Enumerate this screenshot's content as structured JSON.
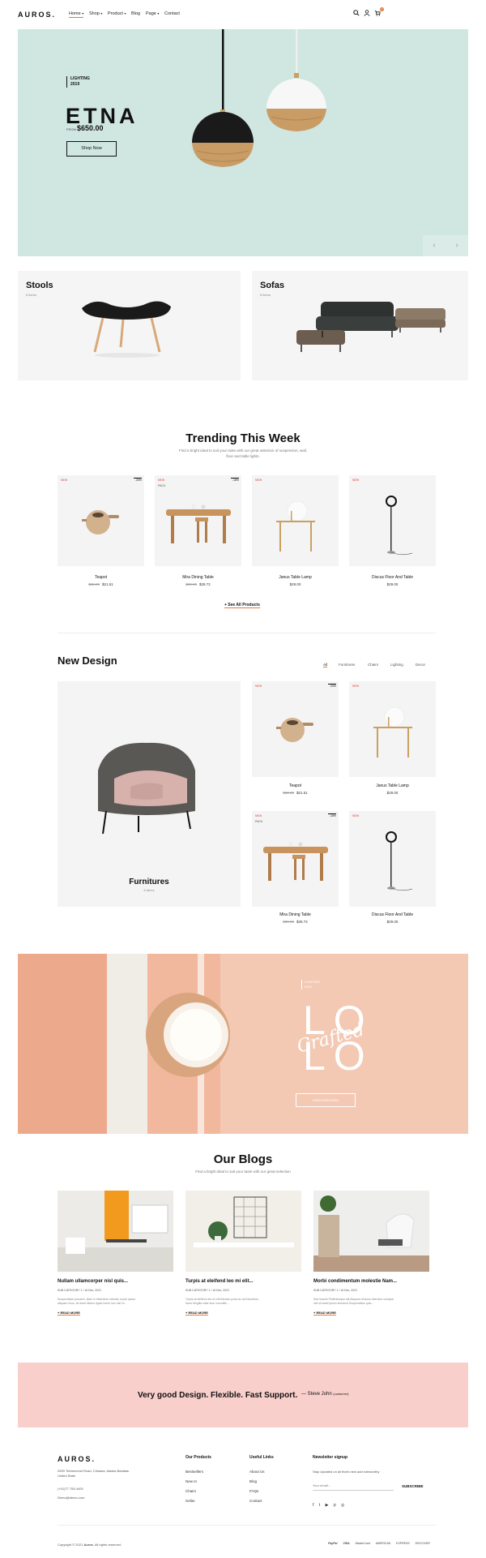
{
  "header": {
    "logo": "AUROS.",
    "nav": [
      {
        "label": "Home",
        "caret": "▾"
      },
      {
        "label": "Shop",
        "caret": "▾"
      },
      {
        "label": "Product",
        "caret": "▾"
      },
      {
        "label": "Blog",
        "caret": ""
      },
      {
        "label": "Page",
        "caret": "▾"
      },
      {
        "label": "Contact",
        "caret": ""
      }
    ],
    "cart_count": "0",
    "accent": "#e07a3f"
  },
  "hero": {
    "tag_line1": "LIGHTING",
    "tag_line2": "2019",
    "title": "ETNA",
    "price_label": "FROM",
    "price": "$650.00",
    "button": "Shop Now",
    "prev_icon": "‹",
    "next_icon": "›",
    "bg_color": "#cfe6e1"
  },
  "categories": [
    {
      "title": "Stools",
      "count": "6 items"
    },
    {
      "title": "Sofas",
      "count": "6 items"
    }
  ],
  "trending": {
    "title": "Trending This Week",
    "subtitle1": "Find a bright ideal to suit your taste with our great selection of suspension, wall,",
    "subtitle2": "floor and table lights.",
    "products": [
      {
        "name": "Teapot",
        "old_price": "$32.00",
        "price": "$21.51",
        "badge": "NEW",
        "badge2": "-33%",
        "badge3": ""
      },
      {
        "name": "Mira Dining Table",
        "old_price": "$30.00",
        "price": "$28.72",
        "badge": "NEW",
        "badge2": "-18%",
        "badge3": "PACK"
      },
      {
        "name": "Janus Table Lamp",
        "old_price": "",
        "price": "$29.00",
        "badge": "NEW",
        "badge2": "",
        "badge3": ""
      },
      {
        "name": "Discus Floor And Table",
        "old_price": "",
        "price": "$29.00",
        "badge": "NEW",
        "badge2": "",
        "badge3": ""
      }
    ],
    "see_all": "+ See All Products"
  },
  "new_design": {
    "title": "New Design",
    "tabs": [
      "All",
      "Furnitures",
      "Chairs",
      "Lighting",
      "Decor"
    ],
    "feature_title": "Furnitures",
    "feature_count": "6 items",
    "products": [
      {
        "name": "Teapot",
        "old_price": "$32.00",
        "price": "$21.51",
        "badge": "NEW",
        "badge2": "-33%",
        "badge3": ""
      },
      {
        "name": "Janus Table Lamp",
        "old_price": "",
        "price": "$29.00",
        "badge": "NEW",
        "badge2": "",
        "badge3": ""
      },
      {
        "name": "Mira Dining Table",
        "old_price": "$30.00",
        "price": "$28.72",
        "badge": "NEW",
        "badge2": "-18%",
        "badge3": "PACK"
      },
      {
        "name": "Discus Floor And Table",
        "old_price": "",
        "price": "$29.00",
        "badge": "NEW",
        "badge2": "",
        "badge3": ""
      }
    ]
  },
  "banner": {
    "tag_line1": "LIGHTING",
    "tag_line2": "2019",
    "big_top": "LO",
    "big_bottom": "LO",
    "script": "Crafted",
    "button": "DISCOVER NOW"
  },
  "blogs": {
    "title": "Our Blogs",
    "subtitle": "Find a bright ideal to suit your taste with our great selection",
    "posts": [
      {
        "title": "Nullam ullamcorper nisl quis...",
        "category": "SUB CATEGORY 1",
        "date": "16 Dec, 2021",
        "excerpt1": "Suspendisse posuere, diam in bibendum lobortis, turpis ipsum",
        "excerpt2": "aliquam risus, sit amet dictum ligula lorem non nisl Ur...",
        "more": "+ READ MORE"
      },
      {
        "title": "Turpis at eleifend leo mi elit...",
        "category": "SUB CATEGORY 1",
        "date": "16 Dec, 2021",
        "excerpt1": "Turpis at eleifend leo mi elit Aenean porta ac sed faucibus.",
        "excerpt2": "Nunc fringilla vitae arcu convallis...",
        "more": "+ READ MORE"
      },
      {
        "title": "Morbi condimentum molestie Nam...",
        "category": "SUB CATEGORY 1",
        "date": "16 Dec, 2021",
        "excerpt1": "Sed mauris Pellentesque elit Aliquam at lacus interdum volutpat",
        "excerpt2": "nisl sit amet ipsum tincidunt Suspendisse quis...",
        "more": "+ READ MORE"
      }
    ]
  },
  "tagline": {
    "text": "Very good Design. Flexible. Fast Support.",
    "dash": "—",
    "author": "Steve John",
    "author_role": "(customer)"
  },
  "footer": {
    "logo": "AUROS.",
    "address1": "2593 Timbercrest Road, Chisana, Alaska Badalas",
    "address2": "United State",
    "phone": "(+01)77 755 4400",
    "email": "Demo@demo.com",
    "products_head": "Our Products",
    "products": [
      "Bestsellers",
      "New In",
      "Chairs",
      "Sofas"
    ],
    "links_head": "Useful Links",
    "links": [
      "About Us",
      "Blog",
      "FAQs",
      "Contact"
    ],
    "newsletter_head": "Newsletter signup",
    "newsletter_text": "Stay Updated on all that's new add noteworthy",
    "email_placeholder": "Your email...",
    "subscribe": "SUBSCRIBE",
    "social": [
      "f",
      "t",
      "▶",
      "p",
      "◎"
    ],
    "copyright_prefix": "Copyright © 2021",
    "copyright_brand": "Auros",
    "copyright_suffix": ". All rights reserved.",
    "payments": [
      "PayPal",
      "VISA",
      "MasterCard",
      "AMERICAN EXPRESS",
      "DISCOVER"
    ]
  }
}
